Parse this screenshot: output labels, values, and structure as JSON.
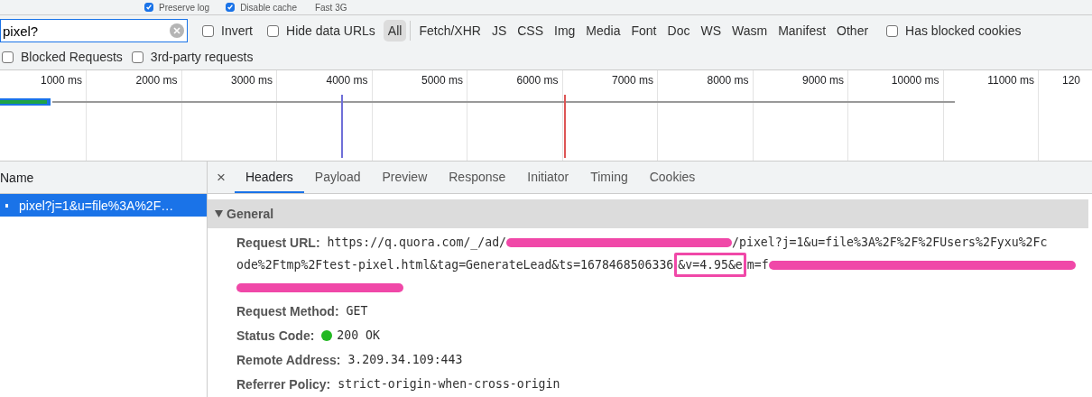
{
  "toolbar": {
    "checkboxes": [
      {
        "label": "Preserve log",
        "checked": true
      },
      {
        "label": "Disable cache",
        "checked": true
      }
    ],
    "throttle": "Fast 3G"
  },
  "filter": {
    "value": "pixel?",
    "options": [
      {
        "label": "Invert",
        "checked": false
      },
      {
        "label": "Hide data URLs",
        "checked": false
      }
    ],
    "types": [
      {
        "label": "All",
        "selected": true
      },
      {
        "label": "Fetch/XHR",
        "selected": false
      },
      {
        "label": "JS",
        "selected": false
      },
      {
        "label": "CSS",
        "selected": false
      },
      {
        "label": "Img",
        "selected": false
      },
      {
        "label": "Media",
        "selected": false
      },
      {
        "label": "Font",
        "selected": false
      },
      {
        "label": "Doc",
        "selected": false
      },
      {
        "label": "WS",
        "selected": false
      },
      {
        "label": "Wasm",
        "selected": false
      },
      {
        "label": "Manifest",
        "selected": false
      },
      {
        "label": "Other",
        "selected": false
      }
    ],
    "more_options": [
      {
        "label": "Has blocked cookies",
        "checked": false
      }
    ],
    "second_row": [
      {
        "label": "Blocked Requests",
        "checked": false
      },
      {
        "label": "3rd-party requests",
        "checked": false
      }
    ]
  },
  "timeline": {
    "ticks": [
      "1000 ms",
      "2000 ms",
      "3000 ms",
      "4000 ms",
      "5000 ms",
      "6000 ms",
      "7000 ms",
      "8000 ms",
      "9000 ms",
      "10000 ms",
      "11000 ms",
      "120"
    ]
  },
  "requests": {
    "column": "Name",
    "rows": [
      {
        "name": "pixel?j=1&u=file%3A%2F…",
        "selected": true
      }
    ]
  },
  "details": {
    "close": "×",
    "tabs": [
      {
        "label": "Headers",
        "selected": true
      },
      {
        "label": "Payload",
        "selected": false
      },
      {
        "label": "Preview",
        "selected": false
      },
      {
        "label": "Response",
        "selected": false
      },
      {
        "label": "Initiator",
        "selected": false
      },
      {
        "label": "Timing",
        "selected": false
      },
      {
        "label": "Cookies",
        "selected": false
      }
    ],
    "section": {
      "title": "General",
      "expanded": true,
      "request_url": {
        "label": "Request URL:",
        "lines": [
          [
            {
              "kind": "text",
              "text": "https://q.quora.com/_/ad/"
            },
            {
              "kind": "redacted"
            },
            {
              "kind": "text",
              "text": "/pixel?j=1&u=file%3A%2F%2F%2FUsers%2Fyxu%2Fc"
            }
          ],
          [
            {
              "kind": "text",
              "text": "ode%2Ftmp%2Ftest-pixel.html&tag=GenerateLead&ts=1678468506336"
            },
            {
              "kind": "highlighted",
              "text": "&v=4.95&e"
            },
            {
              "kind": "text",
              "text": "m=f"
            },
            {
              "kind": "redacted"
            }
          ],
          [
            {
              "kind": "redacted"
            }
          ]
        ]
      },
      "fields": [
        {
          "kind": "plain",
          "label": "Request Method:",
          "value": "GET"
        },
        {
          "kind": "status",
          "label": "Status Code:",
          "value": "200 OK"
        },
        {
          "kind": "plain",
          "label": "Remote Address:",
          "value": "3.209.34.109:443"
        },
        {
          "kind": "plain",
          "label": "Referrer Policy:",
          "value": "strict-origin-when-cross-origin"
        }
      ]
    }
  }
}
